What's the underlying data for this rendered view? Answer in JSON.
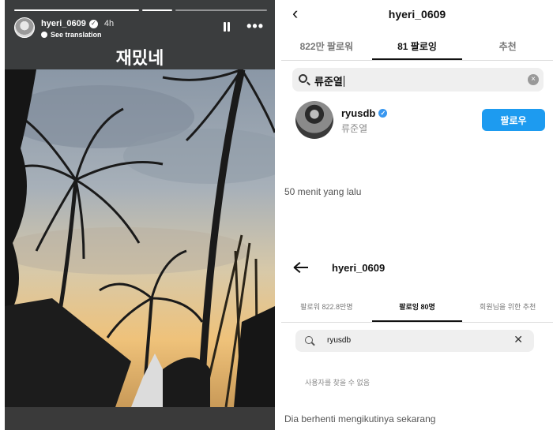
{
  "story": {
    "username": "hyeri_0609",
    "time_ago": "4h",
    "see_translation": "See translation",
    "caption": "재밌네"
  },
  "top_panel": {
    "title": "hyeri_0609",
    "tabs": [
      {
        "label": "822만 팔로워",
        "active": false
      },
      {
        "label": "81 팔로잉",
        "active": true
      },
      {
        "label": "추천",
        "active": false
      }
    ],
    "search_value": "류준열",
    "result": {
      "handle": "ryusdb",
      "name": "류준열",
      "follow_label": "팔로우"
    },
    "caption": "50 menit yang lalu"
  },
  "bottom_panel": {
    "title": "hyeri_0609",
    "tabs": [
      {
        "label": "팔로워 822.8만명",
        "active": false
      },
      {
        "label": "팔로잉 80명",
        "active": true
      },
      {
        "label": "회원님을 위한 추천",
        "active": false
      }
    ],
    "search_value": "ryusdb",
    "empty_message": "사용자를 찾을 수 없음",
    "caption": "Dia berhenti mengikutinya sekarang"
  },
  "colors": {
    "follow_button": "#1d9bf0",
    "verified_badge": "#3897f0",
    "story_background": "#3b3d3e"
  },
  "icons": [
    "pause-icon",
    "more-icon",
    "back-chevron-icon",
    "back-arrow-icon",
    "search-icon",
    "clear-icon",
    "verified-icon",
    "globe-icon"
  ]
}
